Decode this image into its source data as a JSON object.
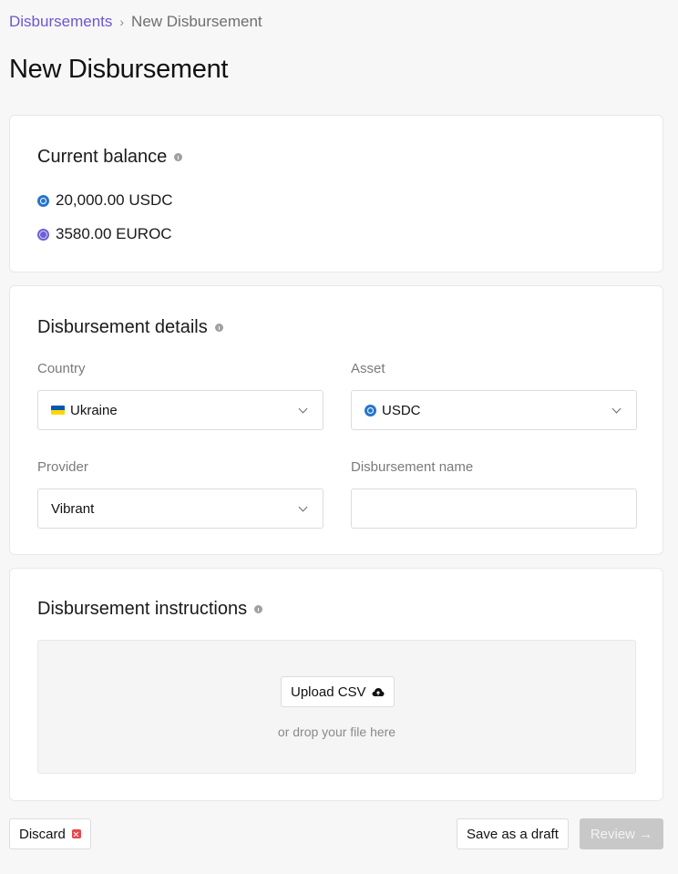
{
  "breadcrumb": {
    "parent": "Disbursements",
    "separator": "›",
    "current": "New Disbursement"
  },
  "page_title": "New Disbursement",
  "balance": {
    "title": "Current balance",
    "items": [
      {
        "icon": "usdc-coin-icon",
        "text": "20,000.00 USDC"
      },
      {
        "icon": "euroc-coin-icon",
        "text": "3580.00 EUROC"
      }
    ]
  },
  "details": {
    "title": "Disbursement details",
    "country": {
      "label": "Country",
      "value": "Ukraine"
    },
    "asset": {
      "label": "Asset",
      "value": "USDC"
    },
    "provider": {
      "label": "Provider",
      "value": "Vibrant"
    },
    "name": {
      "label": "Disbursement name",
      "value": ""
    }
  },
  "instructions": {
    "title": "Disbursement instructions",
    "upload_label": "Upload CSV",
    "drop_hint": "or drop your file here"
  },
  "footer": {
    "discard_label": "Discard",
    "draft_label": "Save as a draft",
    "review_label": "Review →"
  },
  "colors": {
    "accent": "#6e56cf",
    "usdc": "#2775ca",
    "euroc": "#6d5fd6",
    "danger": "#e5484d",
    "disabled": "#c8c8c8"
  }
}
